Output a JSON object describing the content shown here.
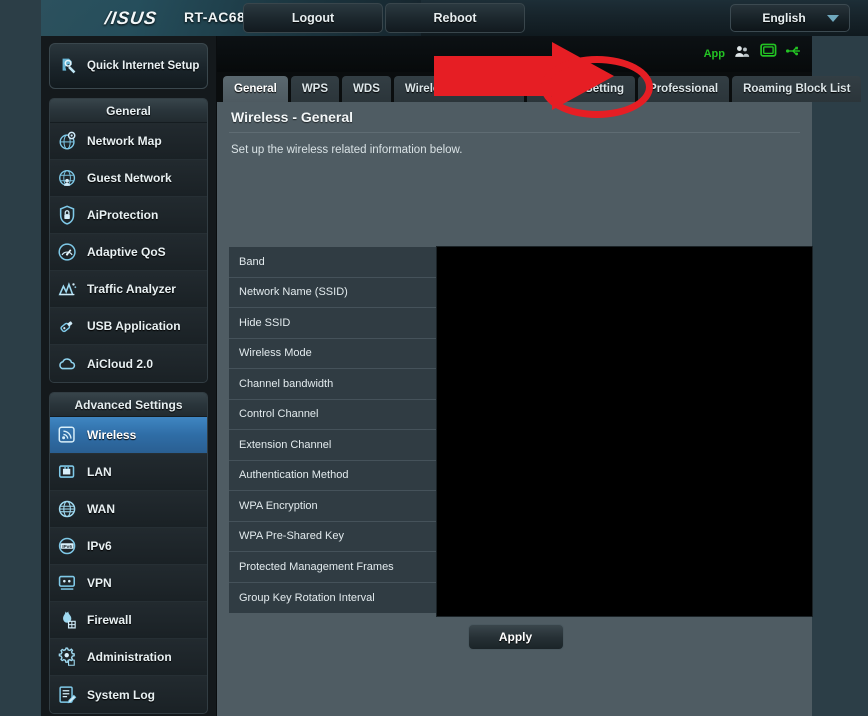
{
  "header": {
    "brand": "/ISUS",
    "model": "RT-AC68U",
    "logout_label": "Logout",
    "reboot_label": "Reboot",
    "language": "English",
    "app_label": "App"
  },
  "sidebar": {
    "quick_setup": "Quick Internet Setup",
    "general_header": "General",
    "general_items": [
      {
        "label": "Network Map",
        "icon": "network-map-icon"
      },
      {
        "label": "Guest Network",
        "icon": "guest-network-icon"
      },
      {
        "label": "AiProtection",
        "icon": "shield-icon"
      },
      {
        "label": "Adaptive QoS",
        "icon": "gauge-icon"
      },
      {
        "label": "Traffic Analyzer",
        "icon": "chart-icon"
      },
      {
        "label": "USB Application",
        "icon": "usb-icon"
      },
      {
        "label": "AiCloud 2.0",
        "icon": "cloud-icon"
      }
    ],
    "advanced_header": "Advanced Settings",
    "advanced_items": [
      {
        "label": "Wireless",
        "icon": "wireless-icon",
        "active": true
      },
      {
        "label": "LAN",
        "icon": "lan-icon",
        "active": false
      },
      {
        "label": "WAN",
        "icon": "wan-globe-icon",
        "active": false
      },
      {
        "label": "IPv6",
        "icon": "ipv6-icon",
        "active": false
      },
      {
        "label": "VPN",
        "icon": "vpn-icon",
        "active": false
      },
      {
        "label": "Firewall",
        "icon": "firewall-flame-icon",
        "active": false
      },
      {
        "label": "Administration",
        "icon": "gear-icon",
        "active": false
      },
      {
        "label": "System Log",
        "icon": "system-log-icon",
        "active": false
      }
    ]
  },
  "tabs": [
    {
      "label": "General",
      "active": true
    },
    {
      "label": "WPS",
      "active": false
    },
    {
      "label": "WDS",
      "active": false
    },
    {
      "label": "Wireless MAC Filter",
      "active": false
    },
    {
      "label": "RADIUS Setting",
      "active": false
    },
    {
      "label": "Professional",
      "active": false
    },
    {
      "label": "Roaming Block List",
      "active": false
    }
  ],
  "panel": {
    "title": "Wireless - General",
    "description": "Set up the wireless related information below.",
    "fields": [
      "Band",
      "Network Name (SSID)",
      "Hide SSID",
      "Wireless Mode",
      "Channel bandwidth",
      "Control Channel",
      "Extension Channel",
      "Authentication Method",
      "WPA Encryption",
      "WPA Pre-Shared Key",
      "Protected Management Frames",
      "Group Key Rotation Interval"
    ],
    "apply_label": "Apply"
  },
  "annotations": {
    "arrow_color": "#e61e24",
    "ellipse_color": "#e61e24",
    "highlighted_tab": "Professional"
  },
  "colors": {
    "page_background": "#2c3e47",
    "sidebar_background": "#14191c",
    "panel_background": "#4f5c63",
    "active_nav": "#2f6da6",
    "accent_green": "#23c423",
    "annotation_red": "#e61e24"
  }
}
